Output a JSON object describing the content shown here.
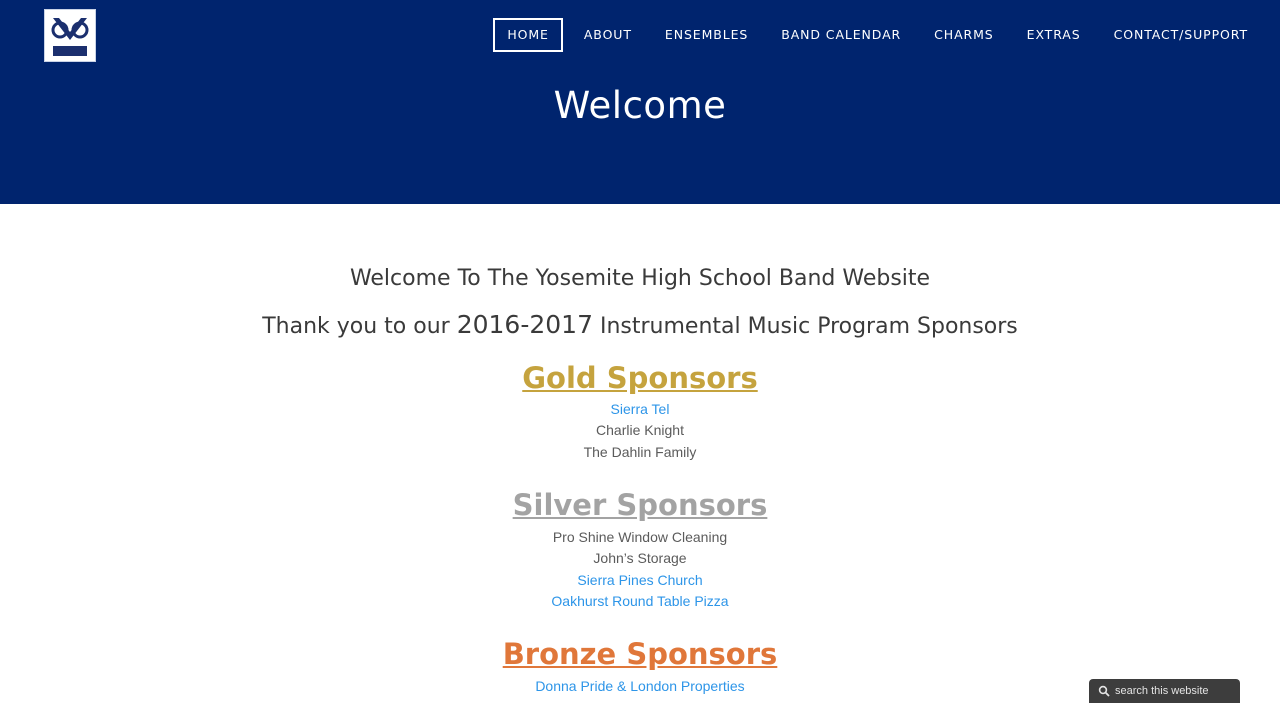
{
  "logo": {
    "alt": "Yosemite HS Band logo",
    "text": "BAND"
  },
  "nav": {
    "items": [
      {
        "label": "HOME",
        "active": true
      },
      {
        "label": "ABOUT"
      },
      {
        "label": "ENSEMBLES"
      },
      {
        "label": "BAND CALENDAR"
      },
      {
        "label": "CHARMS"
      },
      {
        "label": "EXTRAS"
      },
      {
        "label": "CONTACT/SUPPORT"
      }
    ]
  },
  "hero": {
    "title": "Welcome"
  },
  "content": {
    "welcome_line": "Welcome To The Yosemite High School Band Website",
    "thanks_prefix": "Thank you to our ",
    "thanks_year": "2016-2017",
    "thanks_suffix": " Instrumental Music Program Sponsors"
  },
  "sponsors": {
    "gold": {
      "heading": "Gold Sponsors",
      "items": [
        {
          "name": "Sierra Tel",
          "link": true
        },
        {
          "name": "Charlie Knight",
          "link": false
        },
        {
          "name": "The Dahlin Family",
          "link": false
        }
      ]
    },
    "silver": {
      "heading": "Silver Sponsors",
      "items": [
        {
          "name": "Pro Shine Window Cleaning",
          "link": false
        },
        {
          "name": "John’s Storage",
          "link": false
        },
        {
          "name": "Sierra Pines Church",
          "link": true
        },
        {
          "name": "Oakhurst Round Table Pizza",
          "link": true
        }
      ]
    },
    "bronze": {
      "heading": "Bronze Sponsors",
      "items": [
        {
          "name": "Donna Pride & London Properties",
          "link": true
        }
      ]
    }
  },
  "search": {
    "placeholder": "search this website",
    "icon": "search-icon"
  },
  "colors": {
    "header_bg": "#00246e",
    "gold": "#c5a33e",
    "silver": "#a3a3a3",
    "bronze": "#e0773a",
    "link": "#2d95e8"
  }
}
